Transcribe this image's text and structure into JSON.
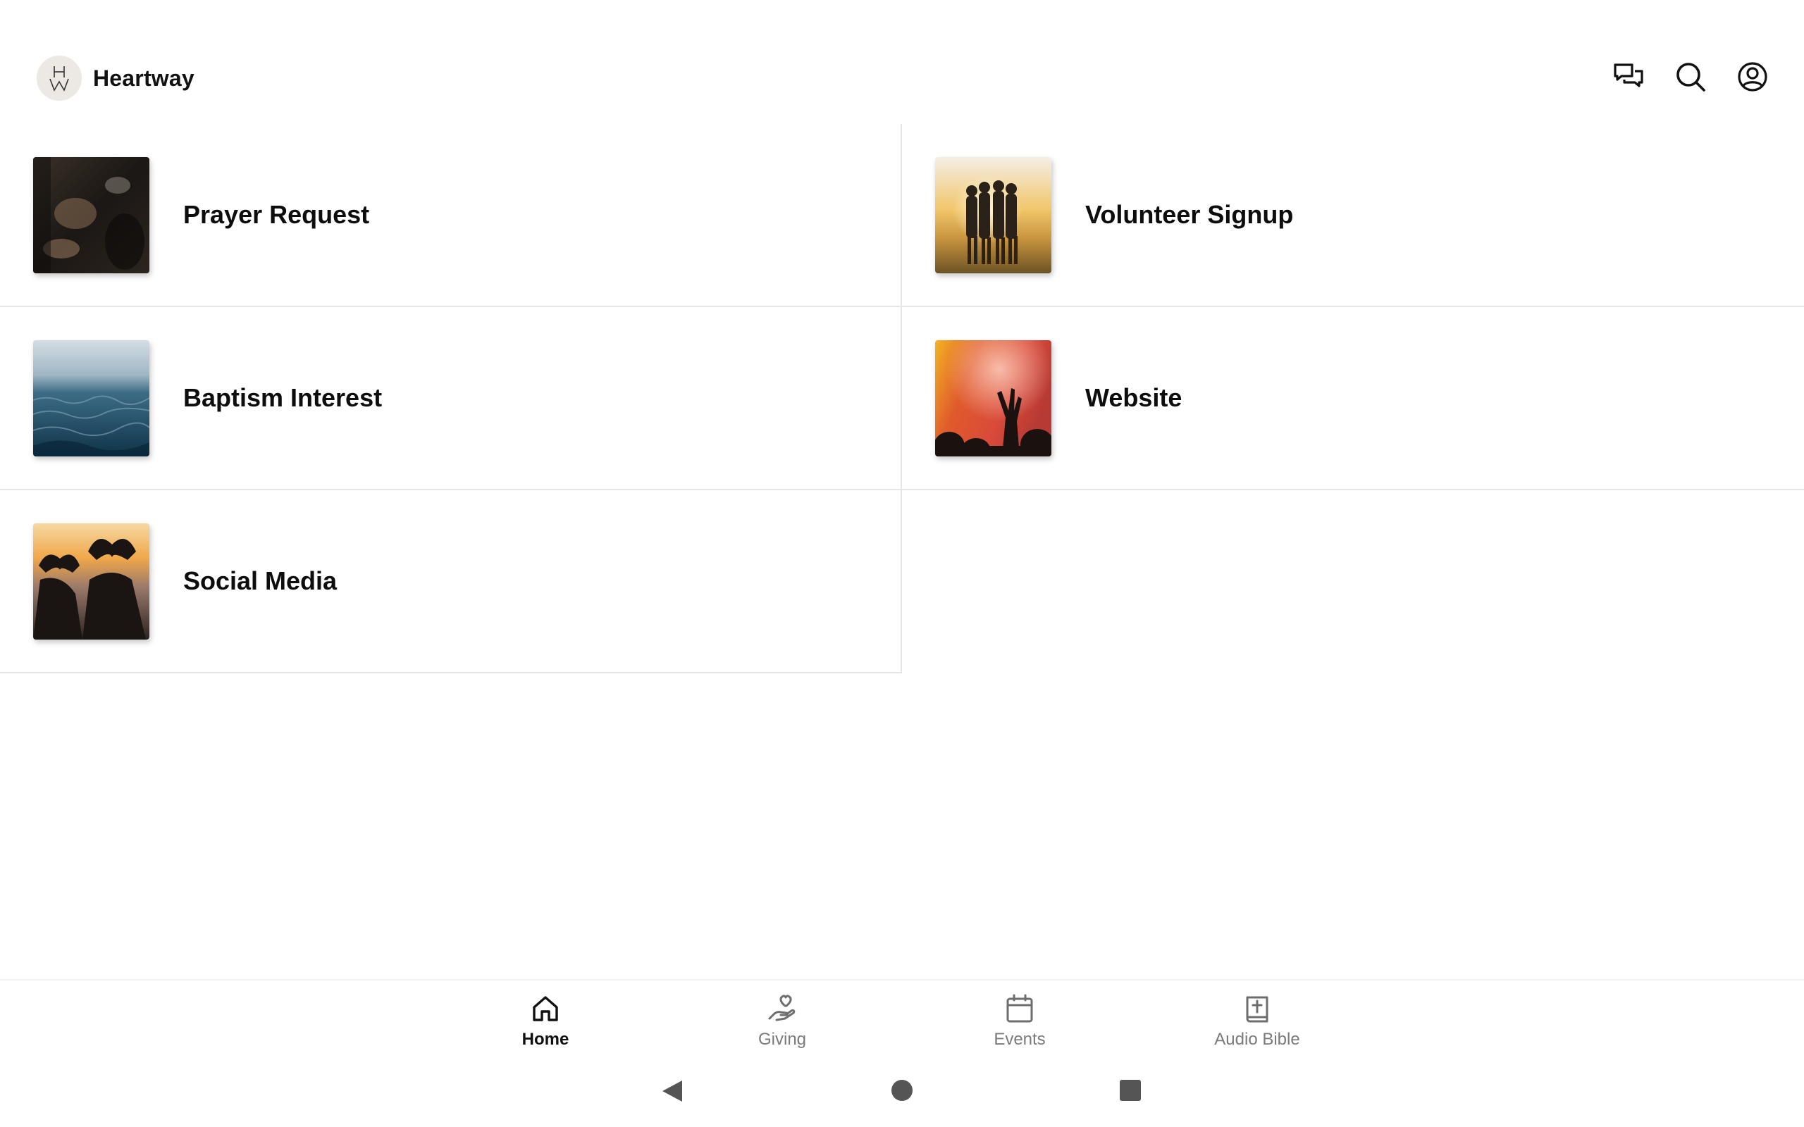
{
  "app": {
    "name": "Heartway",
    "logo_letters": "HW"
  },
  "header": {
    "actions": [
      {
        "icon": "chat-icon"
      },
      {
        "icon": "search-icon"
      },
      {
        "icon": "account-icon"
      }
    ]
  },
  "tiles": [
    {
      "label": "Prayer Request",
      "image": "praying-hands-photo"
    },
    {
      "label": "Volunteer Signup",
      "image": "friends-sunset-photo"
    },
    {
      "label": "Baptism Interest",
      "image": "ocean-water-photo"
    },
    {
      "label": "Website",
      "image": "worship-concert-photo"
    },
    {
      "label": "Social Media",
      "image": "heart-hands-sunset-photo"
    }
  ],
  "tabs": [
    {
      "label": "Home",
      "icon": "home-icon",
      "active": true
    },
    {
      "label": "Giving",
      "icon": "giving-hand-icon",
      "active": false
    },
    {
      "label": "Events",
      "icon": "calendar-icon",
      "active": false
    },
    {
      "label": "Audio Bible",
      "icon": "bible-icon",
      "active": false
    }
  ],
  "colors": {
    "text": "#111111",
    "inactive_tab": "#7a7a7a",
    "divider": "#e6e6e6",
    "logo_bg": "#ece8e4"
  }
}
